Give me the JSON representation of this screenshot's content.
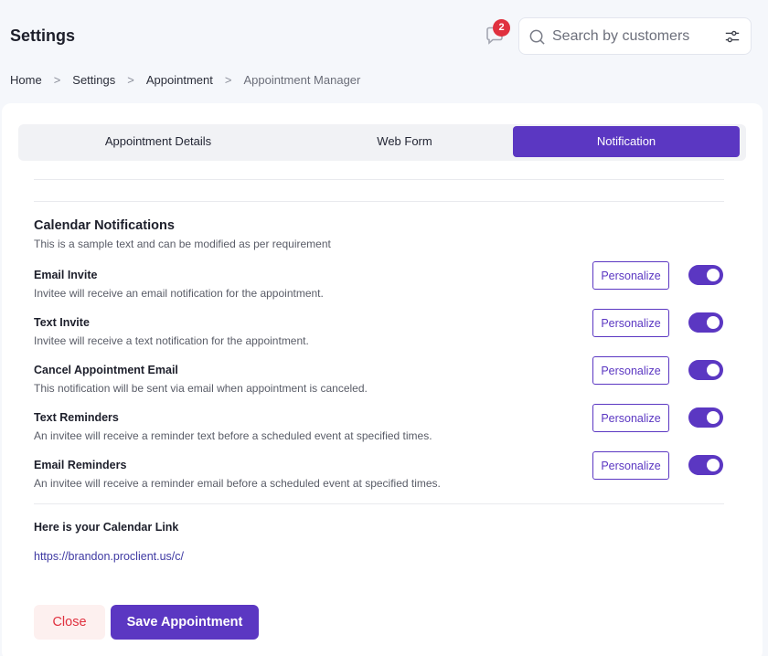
{
  "header": {
    "title": "Settings",
    "notification_count": "2",
    "search_placeholder": "Search by customers"
  },
  "breadcrumb": {
    "items": [
      "Home",
      "Settings",
      "Appointment",
      "Appointment Manager"
    ],
    "separator": ">"
  },
  "tabs": [
    {
      "label": "Appointment Details",
      "active": false
    },
    {
      "label": "Web Form",
      "active": false
    },
    {
      "label": "Notification",
      "active": true
    }
  ],
  "calendar_notifications": {
    "title": "Calendar Notifications",
    "subtitle": "This is a sample text and can be modified as per requirement",
    "personalize_label": "Personalize",
    "items": [
      {
        "title": "Email Invite",
        "description": "Invitee will receive an email notification for the appointment.",
        "enabled": true
      },
      {
        "title": "Text Invite",
        "description": "Invitee will receive a text notification for the appointment.",
        "enabled": true
      },
      {
        "title": "Cancel Appointment Email",
        "description": "This notification will be sent via email when appointment is canceled.",
        "enabled": true
      },
      {
        "title": "Text Reminders",
        "description": "An invitee will receive a reminder text before a scheduled event at specified times.",
        "enabled": true
      },
      {
        "title": "Email Reminders",
        "description": "An invitee will receive a reminder email before a scheduled event at specified times.",
        "enabled": true
      }
    ]
  },
  "calendar_link": {
    "title": "Here is your Calendar Link",
    "url": "https://brandon.proclient.us/c/"
  },
  "actions": {
    "close_label": "Close",
    "save_label": "Save Appointment"
  },
  "colors": {
    "accent": "#5b37c2",
    "danger": "#e0313f",
    "danger_bg": "#fdf0ef"
  }
}
